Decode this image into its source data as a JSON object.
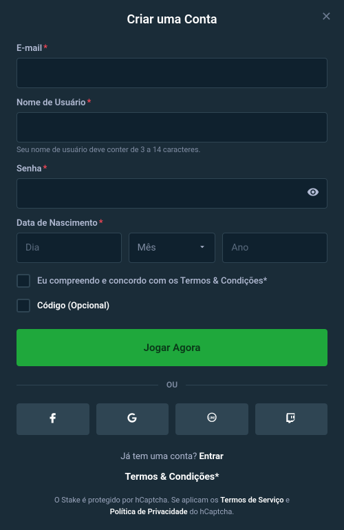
{
  "title": "Criar uma Conta",
  "fields": {
    "email": {
      "label": "E-mail"
    },
    "username": {
      "label": "Nome de Usuário",
      "hint": "Seu nome de usuário deve conter de 3 a 14 caracteres."
    },
    "password": {
      "label": "Senha"
    },
    "dob": {
      "label": "Data de Nascimento",
      "day_placeholder": "Dia",
      "month_placeholder": "Mês",
      "year_placeholder": "Ano"
    }
  },
  "terms_checkbox": "Eu compreendo e concordo com os Termos & Condições*",
  "code_checkbox": "Código (Opcional)",
  "submit": "Jogar Agora",
  "divider": "OU",
  "login_prompt": "Já tem uma conta? ",
  "login_link": "Entrar",
  "terms_link": "Termos & Condições*",
  "captcha": {
    "prefix": "O Stake é protegido por hCaptcha. Se aplicam os ",
    "tos": "Termos de Serviço",
    "and": " e ",
    "privacy": "Política de Privacidade",
    "suffix": " do hCaptcha."
  }
}
